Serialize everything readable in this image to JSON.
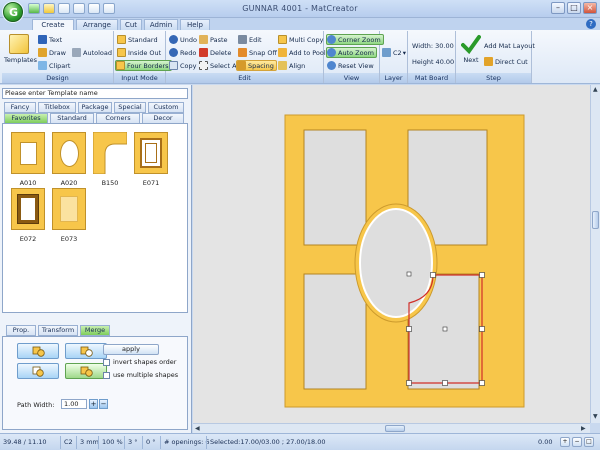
{
  "window": {
    "title": "GUNNAR 4001 - MatCreator",
    "orb_letter": "G"
  },
  "tabs": [
    "Create",
    "Arrange",
    "Cut",
    "Admin",
    "Help"
  ],
  "ribbon": {
    "design": {
      "label": "Design",
      "templates": "Templates",
      "text": "Text",
      "draw": "Draw",
      "clipart": "Clipart",
      "autoload": "Autoload"
    },
    "input_mode": {
      "label": "Input Mode",
      "standard": "Standard",
      "inside_out": "Inside Out",
      "four_borders": "Four Borders"
    },
    "edit": {
      "label": "Edit",
      "undo": "Undo",
      "redo": "Redo",
      "copy": "Copy",
      "paste": "Paste",
      "delete": "Delete",
      "select_all": "Select All",
      "edit": "Edit",
      "snap_off": "Snap Off",
      "spacing": "Spacing",
      "multi_copy": "Multi Copy",
      "add_to_pool": "Add to Pool",
      "align": "Align"
    },
    "view": {
      "label": "View",
      "corner_zoom": "Corner Zoom",
      "auto_zoom": "Auto Zoom",
      "reset_view": "Reset View"
    },
    "layer": {
      "label": "Layer",
      "value": "C2"
    },
    "mat_board_size": {
      "label": "Mat Board Size",
      "width": "Width: 30.00",
      "height": "Height 40.00"
    },
    "step": {
      "label": "Step",
      "next": "Next",
      "add_mat_layout": "Add Mat Layout",
      "direct_cut": "Direct Cut"
    }
  },
  "left_panel": {
    "template_name_placeholder": "Please enter Template name",
    "tabs_row1": [
      "Fancy",
      "Titlebox",
      "Package",
      "Special",
      "Custom"
    ],
    "tabs_row2": [
      "Favorites",
      "Standard",
      "Corners",
      "Decor"
    ],
    "templates": [
      "A010",
      "A020",
      "B150",
      "E071",
      "E072",
      "E073"
    ],
    "bottom_tabs": [
      "Prop.",
      "Transform",
      "Merge"
    ],
    "merge": {
      "apply": "apply",
      "invert": "invert shapes order",
      "multiple": "use multiple shapes",
      "path_width_label": "Path Width:",
      "path_width_value": "1.00"
    }
  },
  "status": {
    "coords": "39.48 / 11.10",
    "layer": "C2",
    "step": "3 mm",
    "zoom": "100 %",
    "angle1": "3 °",
    "angle2": "0 °",
    "openings": "# openings:  6",
    "selected": "Selected:17.00/03.00 ; 27.00/18.00",
    "right_value": "0.00"
  },
  "colors": {
    "mat": "#f7c64a",
    "mat_edge": "#cc9a2c",
    "selection": "#d0302a",
    "canvas": "#e4e4e4"
  }
}
